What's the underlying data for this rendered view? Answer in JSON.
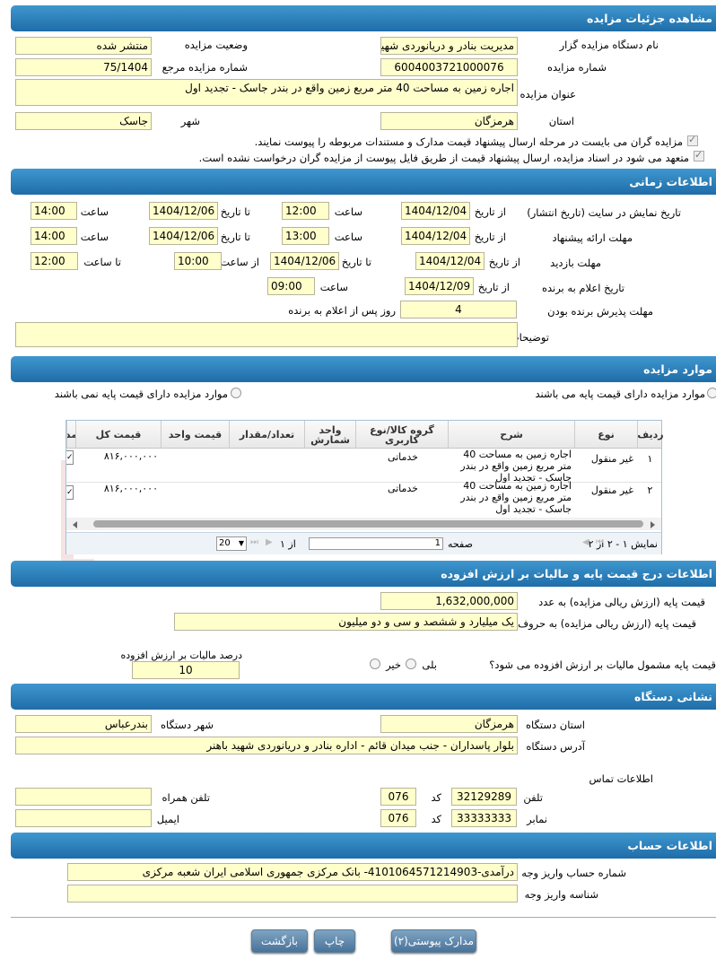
{
  "sections": {
    "details": "مشاهده جزئیات مزایده",
    "timing": "اطلاعات زمانی",
    "items": "موارد مزایده",
    "price": "اطلاعات درج قیمت پایه و مالیات بر ارزش افزوده",
    "address": "نشانی دستگاه",
    "account": "اطلاعات حساب"
  },
  "details": {
    "org_label": "نام دستگاه مزایده گزار",
    "org": "مدیریت بنادر و دریانوردی شهید باهنر",
    "status_label": "وضعیت مزایده",
    "status": "منتشر شده",
    "number_label": "شماره مزایده",
    "number": "6004003721000076",
    "ref_label": "شماره مزایده مرجع",
    "ref": "75/1404",
    "title_label": "عنوان مزایده",
    "title": "اجاره زمین به مساحت 40 متر مربع زمین واقع در بندر جاسک - تجدید اول",
    "province_label": "استان",
    "province": "هرمزگان",
    "city_label": "شهر",
    "city": "جاسک",
    "check1": "مزایده گران می بایست در مرحله ارسال پیشنهاد قیمت مدارک و مستندات مربوطه را پیوست نمایند.",
    "check2": "متعهد می شود در اسناد مزایده، ارسال پیشنهاد قیمت از طریق فایل پیوست از مزایده گران درخواست نشده است."
  },
  "timing": {
    "row1_label": "تاریخ نمایش در سایت (تاریخ انتشار)",
    "row1_from": "1404/12/04",
    "row1_from_time": "12:00",
    "row1_to": "1404/12/06",
    "row1_to_time": "14:00",
    "row2_label": "مهلت ارائه پیشنهاد",
    "row2_from": "1404/12/04",
    "row2_from_time": "13:00",
    "row2_to": "1404/12/06",
    "row2_to_time": "14:00",
    "row3_label": "مهلت بازدید",
    "row3_from": "1404/12/04",
    "row3_to": "1404/12/06",
    "row3_from_time": "10:00",
    "row3_to_time": "12:00",
    "row4_label": "تاریخ اعلام به برنده",
    "row4_from": "1404/12/09",
    "row4_time": "09:00",
    "row5_label": "مهلت پذیرش برنده بودن",
    "row5_value": "4",
    "row5_suffix": "روز پس از اعلام به برنده",
    "notes_label": "توضیحات",
    "from_date": "از تاریخ",
    "to_date": "تا تاریخ",
    "time": "ساعت",
    "from_time": "از ساعت",
    "to_time": "تا ساعت"
  },
  "items": {
    "radio1": "موارد مزایده دارای قیمت پایه می باشند",
    "radio2": "موارد مزایده دارای قیمت پایه نمی باشند",
    "columns": [
      "ردیف",
      "نوع",
      "شرح",
      "گروه کالا/نوع کاربری",
      "واحد شمارش",
      "تعداد/مقدار",
      "قیمت واحد",
      "قیمت کل",
      "مد"
    ],
    "rows": [
      {
        "n": "۱",
        "type": "غیر منقول",
        "desc": "اجاره زمین به مساحت 40 متر مربع زمین واقع در بندر جاسک - تجدید اول",
        "group": "خدماتی",
        "total": "۸۱۶,۰۰۰,۰۰۰"
      },
      {
        "n": "۲",
        "type": "غیر منقول",
        "desc": "اجاره زمین به مساحت 40 متر مربع زمین واقع در بندر جاسک - تجدید اول",
        "group": "خدماتی",
        "total": "۸۱۶,۰۰۰,۰۰۰"
      }
    ],
    "pager": {
      "summary": "نمایش ۱ - ۲ از ۲",
      "page_label": "صفحه",
      "page": "1",
      "of": "از ۱",
      "page_size": "20"
    }
  },
  "price": {
    "base_num_label": "قیمت پایه (ارزش ریالی مزایده) به عدد",
    "base_num": "1,632,000,000",
    "base_words_label": "قیمت پایه (ارزش ریالی مزایده) به حروف",
    "base_words": "یک میلیارد و ششصد و سی و دو میلیون",
    "vat_q": "قیمت پایه مشمول مالیات بر ارزش افزوده می شود؟",
    "yes": "بلی",
    "no": "خیر",
    "vat_label": "درصد مالیات بر ارزش افزوده",
    "vat": "10"
  },
  "address": {
    "province_label": "استان دستگاه",
    "province": "هرمزگان",
    "city_label": "شهر دستگاه",
    "city": "بندرعباس",
    "addr_label": "آدرس دستگاه",
    "addr": "بلوار پاسداران - جنب میدان قائم - اداره بنادر و دریانوردی شهید باهنر",
    "contact": "اطلاعات تماس",
    "phone_label": "تلفن",
    "phone": "32129289",
    "phone_code": "076",
    "code_label": "کد",
    "mobile_label": "تلفن همراه",
    "mobile": "",
    "fax_label": "نمابر",
    "fax": "33333333",
    "fax_code": "076",
    "email_label": "ایمیل",
    "email": ""
  },
  "account": {
    "acc_label": "شماره حساب واریز وجه",
    "acc": "درآمدی-4101064571214903- بانک مرکزی جمهوری اسلامی ایران شعبه مرکزی",
    "id_label": "شناسه واریز وجه",
    "id": ""
  },
  "buttons": {
    "docs": "مدارک پیوستی(۲)",
    "print": "چاپ",
    "back": "بازگشت"
  }
}
